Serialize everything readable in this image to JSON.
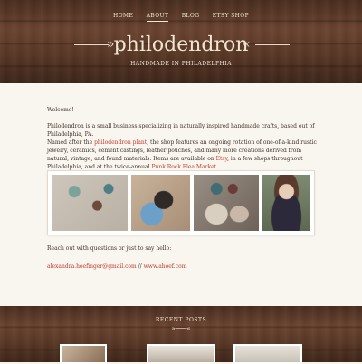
{
  "nav": {
    "items": [
      "HOME",
      "ABOUT",
      "BLOG",
      "ETSY SHOP"
    ],
    "active": "ABOUT"
  },
  "site": {
    "title": "philodendron",
    "tagline": "HANDMADE IN PHILADELPHIA"
  },
  "content": {
    "welcome": "Welcome!",
    "intro": "Philodendron is a small business specializing in naturally inspired handmade crafts, based out of Philadelphia, PA.",
    "named_before": "Named after the ",
    "named_link": "philodendron plant",
    "named_after": ", the shop features an ongoing rotation of one-of-a-kind rustic jewelry, ceramics, cement castings, leather pouches, and many more creations derived from natural, vintage, and found materials. Items are available on ",
    "etsy_link": "Etsy",
    "shops_text": ", in a few shops throughout Philadelphia, and at the twice-annual ",
    "market_link": "Punk Rock Flea Market",
    "period": ".",
    "contact_line": "Reach out with questions or just to say hello:",
    "email": "alexandra.hoefinger@gmail.com",
    "sep": " // ",
    "website": "www.ahoef.com"
  },
  "footer": {
    "recent_posts": "RECENT POSTS"
  },
  "colors": {
    "link": "#c0392b",
    "wood": "#5a3826",
    "page_bg": "#f9f6ef"
  }
}
